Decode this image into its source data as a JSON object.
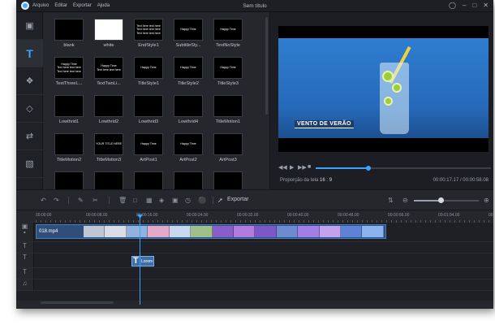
{
  "app": {
    "menu": [
      "Arquivo",
      "Editar",
      "Exportar",
      "Ajuda"
    ],
    "title": "Sem título"
  },
  "sidebar": {
    "items": [
      {
        "icon": "media-icon"
      },
      {
        "icon": "text-icon",
        "label": "T",
        "active": true
      },
      {
        "icon": "filters-icon"
      },
      {
        "icon": "overlays-icon"
      },
      {
        "icon": "transitions-icon"
      },
      {
        "icon": "elements-icon"
      }
    ]
  },
  "library": {
    "tiles": [
      {
        "label": "blank",
        "style": "black",
        "lines": []
      },
      {
        "label": "white",
        "style": "white",
        "lines": []
      },
      {
        "label": "EndStyle1",
        "style": "black",
        "lines": [
          "Text here text here",
          "Text here text here",
          "Text here text here"
        ]
      },
      {
        "label": "SubtitleSty...",
        "style": "black",
        "lines": [
          "Happy Time"
        ]
      },
      {
        "label": "TextNoStyle",
        "style": "black",
        "lines": [
          "Happy Time"
        ]
      },
      {
        "label": "TextThreeL...",
        "style": "black",
        "lines": [
          "Happy Time",
          "Text here text here",
          "Text here text here"
        ]
      },
      {
        "label": "TextTwoLi...",
        "style": "black",
        "lines": [
          "Happy Time",
          "Text here text here"
        ]
      },
      {
        "label": "TitleStyle1",
        "style": "black",
        "lines": [
          "Happy Time"
        ]
      },
      {
        "label": "TitleStyle2",
        "style": "black",
        "lines": [
          "Happy Time"
        ]
      },
      {
        "label": "TitleStyle3",
        "style": "black",
        "lines": [
          "Happy Time"
        ]
      },
      {
        "label": "Lowthrid1",
        "style": "black",
        "lines": [
          ""
        ]
      },
      {
        "label": "Lowthrid2",
        "style": "black",
        "lines": [
          ""
        ]
      },
      {
        "label": "Lowthrid3",
        "style": "black",
        "lines": [
          ""
        ]
      },
      {
        "label": "Lowthrid4",
        "style": "black",
        "lines": [
          ""
        ]
      },
      {
        "label": "TitleMotion1",
        "style": "black",
        "lines": [
          ""
        ]
      },
      {
        "label": "TitleMotion2",
        "style": "black",
        "lines": [
          ""
        ]
      },
      {
        "label": "TitleMotion3",
        "style": "black",
        "lines": [
          "YOUR TITLE HERE"
        ]
      },
      {
        "label": "ArtPost1",
        "style": "black",
        "lines": [
          "Happy Time"
        ]
      },
      {
        "label": "ArtPost2",
        "style": "black",
        "lines": [
          "Happy Time"
        ]
      },
      {
        "label": "ArtPost3",
        "style": "black",
        "lines": [
          ""
        ]
      },
      {
        "label": "",
        "style": "black",
        "lines": [
          ""
        ]
      },
      {
        "label": "",
        "style": "black",
        "lines": [
          ""
        ]
      },
      {
        "label": "",
        "style": "black",
        "lines": [
          ""
        ]
      },
      {
        "label": "",
        "style": "black",
        "lines": [
          ""
        ]
      },
      {
        "label": "",
        "style": "black",
        "lines": [
          ""
        ]
      }
    ]
  },
  "preview": {
    "overlay_title": "VENTO DE VERÃO",
    "ratio_label": "Proporção da tela",
    "ratio_value": "16 : 9",
    "time": "00:00:17.17 / 00:00:58.08",
    "progress": 0.3
  },
  "toolbar": {
    "export_label": "Exportar",
    "zoom": 0.4
  },
  "timeline": {
    "ticks": [
      "00:00:00",
      "00:00:08.00",
      "00:00:16.00",
      "00:00:24.00",
      "00:00:32.00",
      "00:00:40.00",
      "00:00:48.00",
      "00:00:56.00",
      "00:01:04.00",
      "00:01:12.00"
    ],
    "video_clip": "018.mp4",
    "text_clip": "Lorem",
    "clip_colors": [
      "#bfc6d4",
      "#d9dee6",
      "#8fb2e0",
      "#e3a9c9",
      "#c7d9ef",
      "#9fc08a",
      "#8a5ec8",
      "#b27be0",
      "#7b57c7",
      "#6d8bd0",
      "#a37ee6",
      "#c3a3ef",
      "#5d83d6",
      "#8ab4f0"
    ]
  }
}
